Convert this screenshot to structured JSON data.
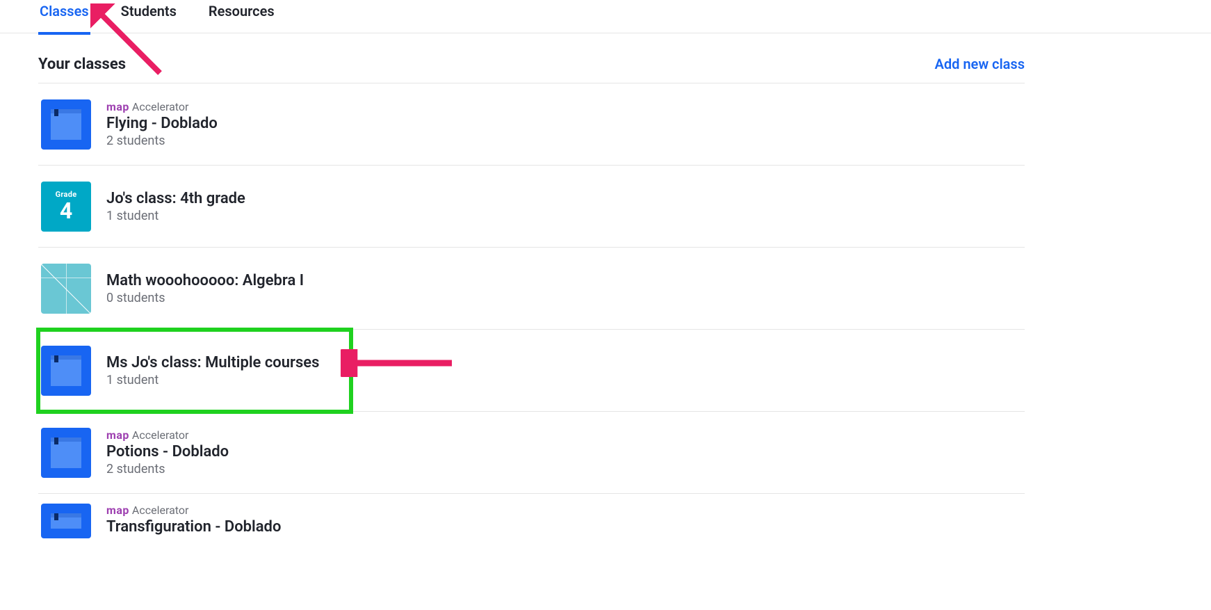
{
  "tabs": [
    {
      "label": "Classes",
      "active": true
    },
    {
      "label": "Students",
      "active": false
    },
    {
      "label": "Resources",
      "active": false
    }
  ],
  "section_title": "Your classes",
  "add_link": "Add new class",
  "map_label": {
    "logo": "map",
    "word": "Accelerator"
  },
  "grade_tile": {
    "line1": "Grade",
    "line2": "4"
  },
  "classes": [
    {
      "icon": "book",
      "map_accel": true,
      "name": "Flying - Doblado",
      "sub": "2 students",
      "highlight": false
    },
    {
      "icon": "grade",
      "map_accel": false,
      "name": "Jo's class: 4th grade",
      "sub": "1 student",
      "highlight": false
    },
    {
      "icon": "tiles",
      "map_accel": false,
      "name": "Math wooohooooo: Algebra I",
      "sub": "0 students",
      "highlight": false
    },
    {
      "icon": "book",
      "map_accel": false,
      "name": "Ms Jo's class: Multiple courses",
      "sub": "1 student",
      "highlight": true
    },
    {
      "icon": "book",
      "map_accel": true,
      "name": "Potions - Doblado",
      "sub": "2 students",
      "highlight": false
    },
    {
      "icon": "book",
      "map_accel": true,
      "name": "Transfiguration - Doblado",
      "sub": "",
      "highlight": false
    }
  ],
  "annotations": {
    "arrow_tab": {
      "type": "arrow",
      "target": "tab-classes"
    },
    "arrow_class": {
      "type": "arrow",
      "target": "class-row-3"
    }
  }
}
